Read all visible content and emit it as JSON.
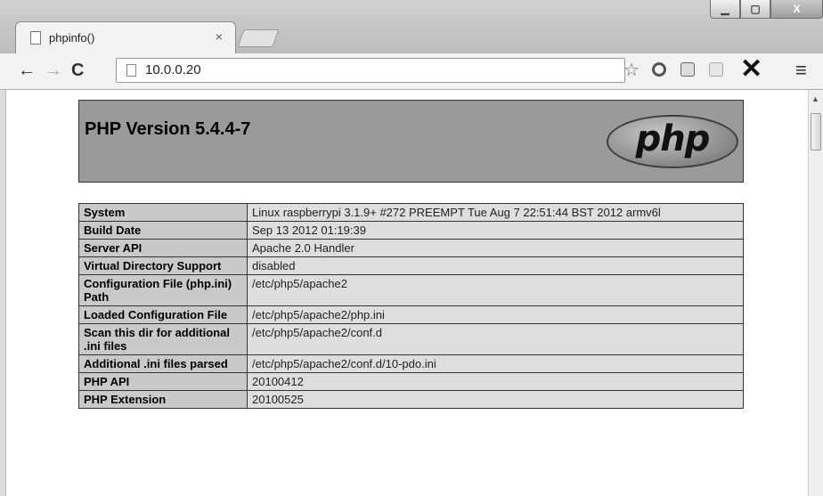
{
  "browser": {
    "tab_title": "phpinfo()",
    "tab_close": "×",
    "url": "10.0.0.20",
    "window_buttons": {
      "minimize": "▁",
      "maximize": "▢",
      "close": "X"
    },
    "icons": [
      "back-arrow-icon",
      "forward-arrow-icon",
      "reload-icon",
      "page-icon",
      "star-icon",
      "extension-icon",
      "x-icon",
      "menu-icon"
    ]
  },
  "phpinfo": {
    "version_title": "PHP Version 5.4.4-7",
    "logo_text": "php",
    "rows": [
      {
        "key": "System",
        "value": "Linux raspberrypi 3.1.9+ #272 PREEMPT Tue Aug 7 22:51:44 BST 2012 armv6l"
      },
      {
        "key": "Build Date",
        "value": "Sep 13 2012 01:19:39"
      },
      {
        "key": "Server API",
        "value": "Apache 2.0 Handler"
      },
      {
        "key": "Virtual Directory Support",
        "value": "disabled"
      },
      {
        "key": "Configuration File (php.ini) Path",
        "value": "/etc/php5/apache2"
      },
      {
        "key": "Loaded Configuration File",
        "value": "/etc/php5/apache2/php.ini"
      },
      {
        "key": "Scan this dir for additional .ini files",
        "value": "/etc/php5/apache2/conf.d"
      },
      {
        "key": "Additional .ini files parsed",
        "value": "/etc/php5/apache2/conf.d/10-pdo.ini"
      },
      {
        "key": "PHP API",
        "value": "20100412"
      },
      {
        "key": "PHP Extension",
        "value": "20100525"
      }
    ]
  }
}
